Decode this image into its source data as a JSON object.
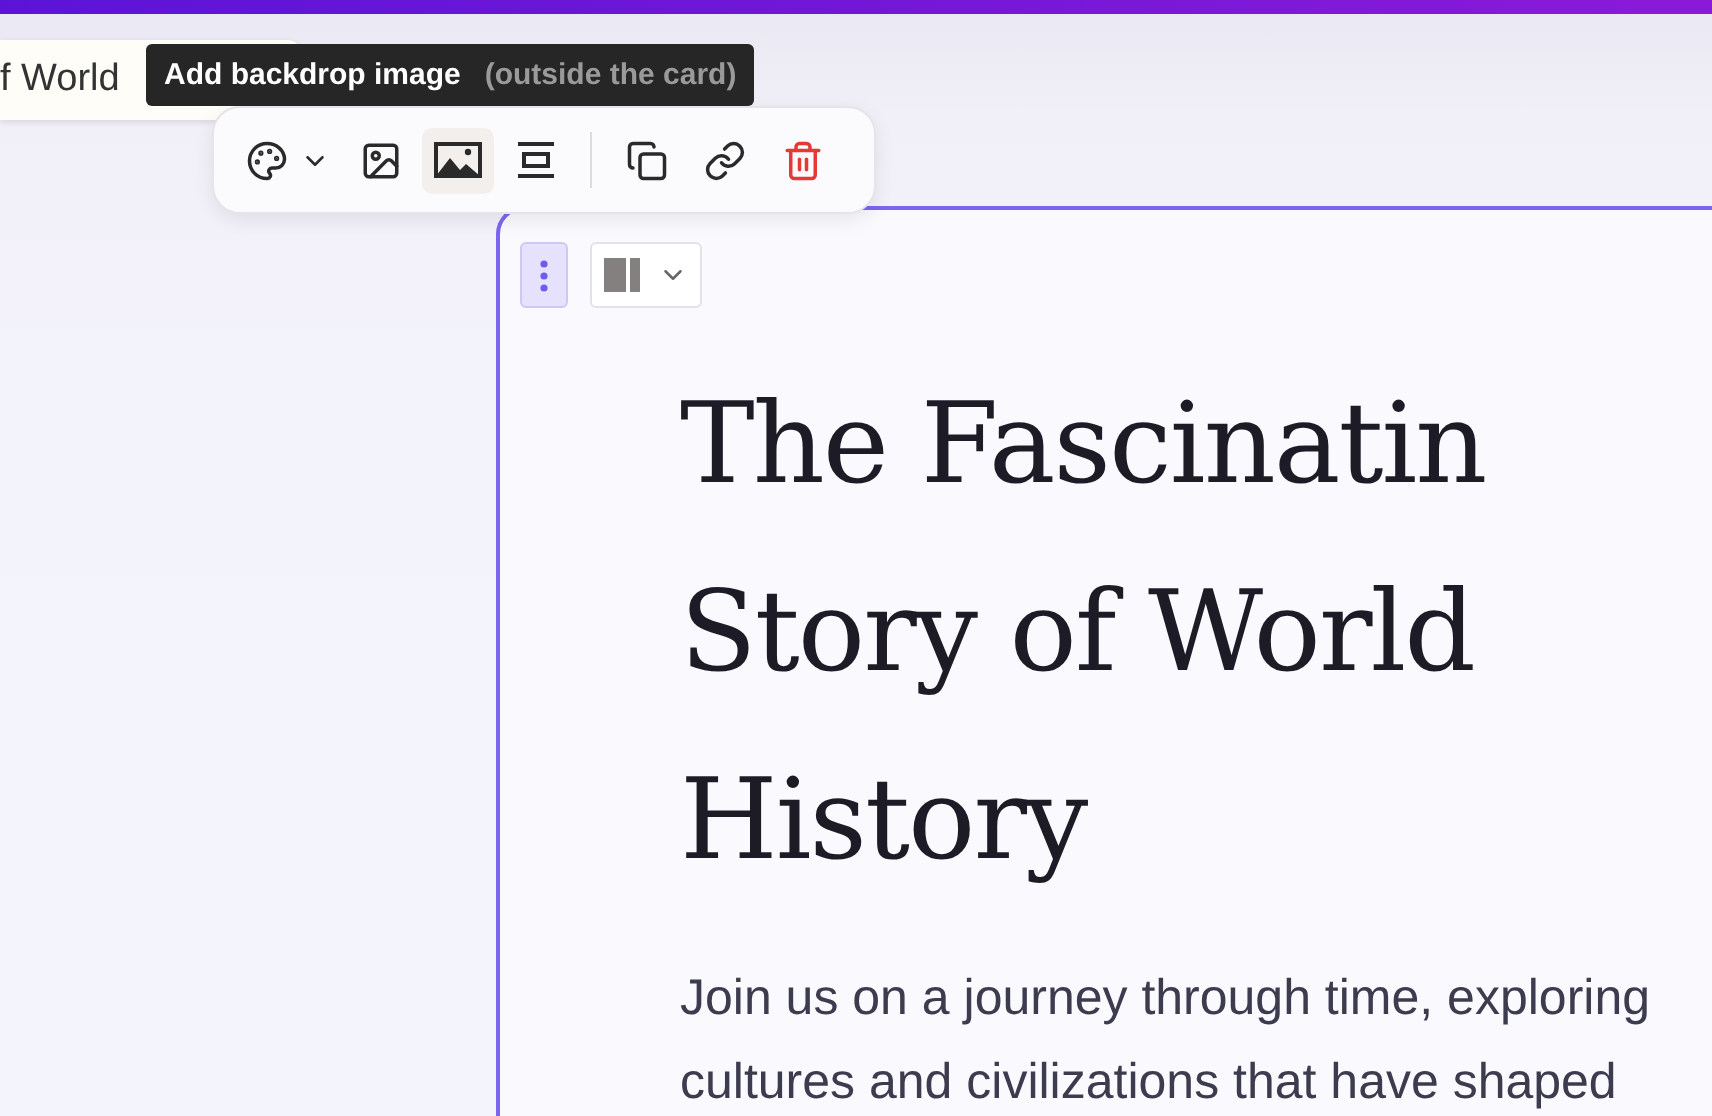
{
  "background_tab": {
    "title": "f World"
  },
  "tooltip": {
    "label": "Add backdrop image",
    "hint": "(outside the card)"
  },
  "toolbar": {
    "buttons": [
      {
        "kind": "theme",
        "selected": false
      },
      {
        "kind": "image",
        "selected": false
      },
      {
        "kind": "backdrop",
        "selected": true
      },
      {
        "kind": "spacing",
        "selected": false
      },
      {
        "kind": "divider"
      },
      {
        "kind": "duplicate",
        "selected": false
      },
      {
        "kind": "link",
        "selected": false
      },
      {
        "kind": "delete",
        "selected": false
      }
    ]
  },
  "card": {
    "title_lines": [
      "The Fascinatin",
      "Story of World",
      "History"
    ],
    "body_lines": [
      "Join us on a journey through time, exploring",
      "cultures and civilizations that have shaped"
    ]
  }
}
